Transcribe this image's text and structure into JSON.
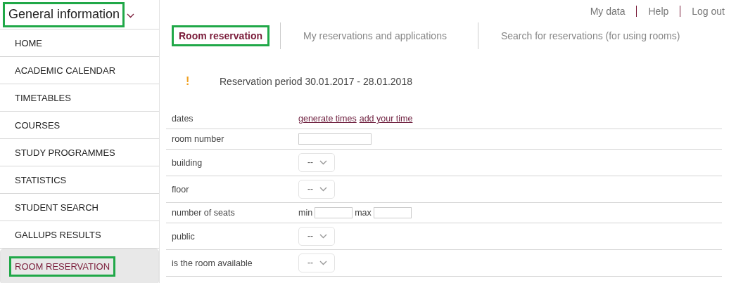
{
  "sidebar": {
    "title": "General information",
    "highlighted": true,
    "items": [
      {
        "label": "HOME",
        "selected": false,
        "highlighted": false
      },
      {
        "label": "ACADEMIC CALENDAR",
        "selected": false,
        "highlighted": false
      },
      {
        "label": "TIMETABLES",
        "selected": false,
        "highlighted": false
      },
      {
        "label": "COURSES",
        "selected": false,
        "highlighted": false
      },
      {
        "label": "STUDY PROGRAMMES",
        "selected": false,
        "highlighted": false
      },
      {
        "label": "STATISTICS",
        "selected": false,
        "highlighted": false
      },
      {
        "label": "STUDENT SEARCH",
        "selected": false,
        "highlighted": false
      },
      {
        "label": "GALLUPS RESULTS",
        "selected": false,
        "highlighted": false
      },
      {
        "label": "ROOM RESERVATION",
        "selected": true,
        "highlighted": true
      }
    ]
  },
  "top_links": [
    "My data",
    "Help",
    "Log out"
  ],
  "tabs": [
    {
      "label": "Room reservation",
      "selected": true,
      "highlighted": true
    },
    {
      "label": "My reservations and applications",
      "selected": false,
      "highlighted": false
    },
    {
      "label": "Search for reservations (for using rooms)",
      "selected": false,
      "highlighted": false
    }
  ],
  "notice": {
    "icon": "!",
    "text": "Reservation period 30.01.2017 - 28.01.2018"
  },
  "form": [
    {
      "kind": "links",
      "label": "dates",
      "links": [
        "generate times",
        "add your time"
      ]
    },
    {
      "kind": "text",
      "label": "room number"
    },
    {
      "kind": "select",
      "label": "building",
      "value": "--"
    },
    {
      "kind": "select",
      "label": "floor",
      "value": "--"
    },
    {
      "kind": "range",
      "label": "number of seats",
      "min_label": "min",
      "max_label": "max"
    },
    {
      "kind": "select",
      "label": "public",
      "value": "--"
    },
    {
      "kind": "select",
      "label": "is the room available",
      "value": "--"
    }
  ]
}
